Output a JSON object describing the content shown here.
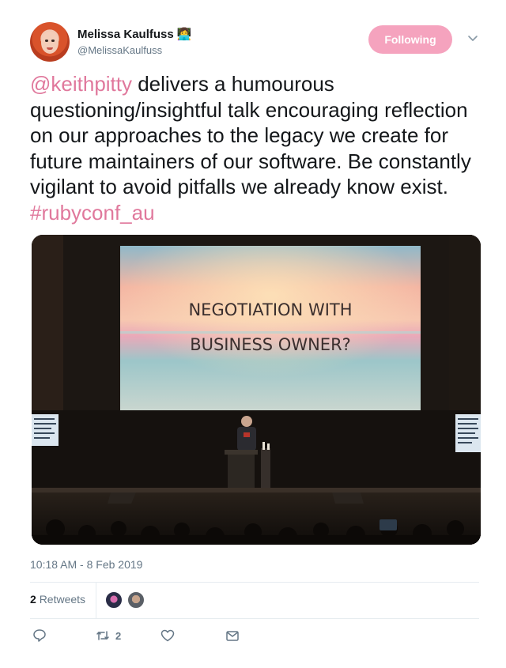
{
  "user": {
    "name": "Melissa Kaulfuss",
    "emoji": "👩‍💻",
    "handle": "@MelissaKaulfuss"
  },
  "follow_button": {
    "label": "Following",
    "color": "#f5a3be"
  },
  "tweet": {
    "mention": "@keithpitty",
    "body": " delivers a humourous questioning/insightful talk encouraging reflection on our approaches to the legacy we create for future maintainers of our software. Be constantly vigilant to avoid pitfalls we already know exist. ",
    "hashtag": "#rubyconf_au",
    "link_color": "#e0789c"
  },
  "media": {
    "slide_line1": "NEGOTIATION WITH",
    "slide_line2": "BUSINESS OWNER?"
  },
  "timestamp": "10:18 AM - 8 Feb 2019",
  "stats": {
    "retweets_count": "2",
    "retweets_label": "Retweets"
  },
  "actions": {
    "reply_icon": "reply-icon",
    "retweet_icon": "retweet-icon",
    "retweet_count": "2",
    "like_icon": "heart-icon",
    "dm_icon": "envelope-icon"
  }
}
